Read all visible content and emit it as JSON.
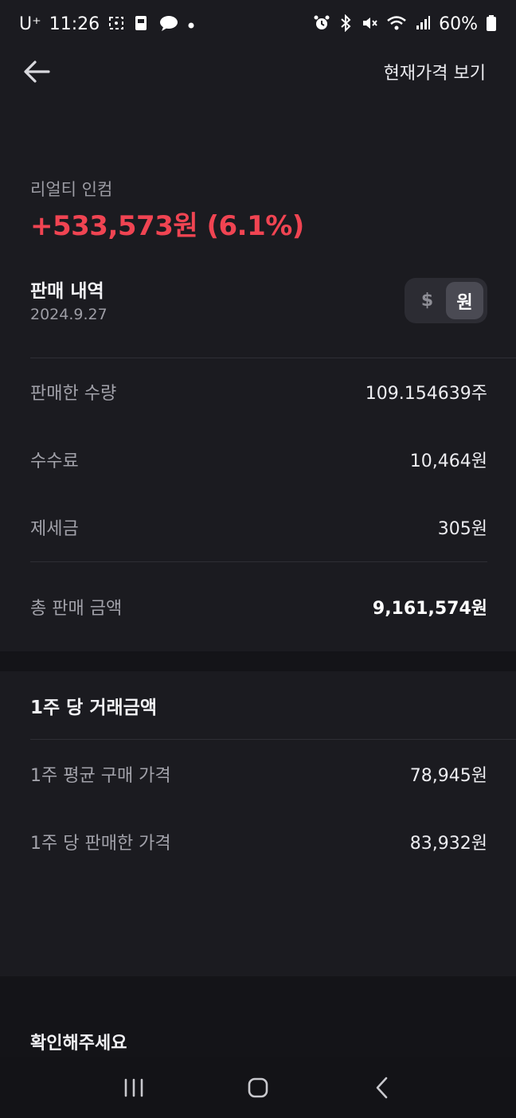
{
  "status_bar": {
    "carrier": "U⁺",
    "time": "11:26",
    "battery": "60%",
    "left_icons": [
      "screenshot-icon",
      "sim-icon",
      "chat-icon",
      "dot-icon"
    ],
    "right_icons": [
      "alarm-icon",
      "bluetooth-icon",
      "mute-icon",
      "wifi-icon",
      "signal-icon",
      "battery-icon"
    ]
  },
  "header": {
    "back_icon": "arrow-left-icon",
    "action_label": "현재가격 보기"
  },
  "summary": {
    "stock_name": "리얼티 인컴",
    "profit": "+533,573원 (6.1%)",
    "profit_color": "#f04452"
  },
  "sales": {
    "title": "판매 내역",
    "date": "2024.9.27",
    "currency_toggle": {
      "options": [
        "$",
        "원"
      ],
      "selected": "원"
    },
    "rows": [
      {
        "label": "판매한 수량",
        "value": "109.154639주"
      },
      {
        "label": "수수료",
        "value": "10,464원"
      },
      {
        "label": "제세금",
        "value": "305원"
      }
    ],
    "total": {
      "label": "총 판매 금액",
      "value": "9,161,574원"
    }
  },
  "per_share": {
    "title": "1주 당 거래금액",
    "rows": [
      {
        "label": "1주 평균 구매 가격",
        "value": "78,945원"
      },
      {
        "label": "1주 당 판매한 가격",
        "value": "83,932원"
      }
    ]
  },
  "notice": {
    "title": "확인해주세요"
  },
  "nav_bar": {
    "icons": [
      "recents-icon",
      "home-icon",
      "back-icon"
    ]
  }
}
